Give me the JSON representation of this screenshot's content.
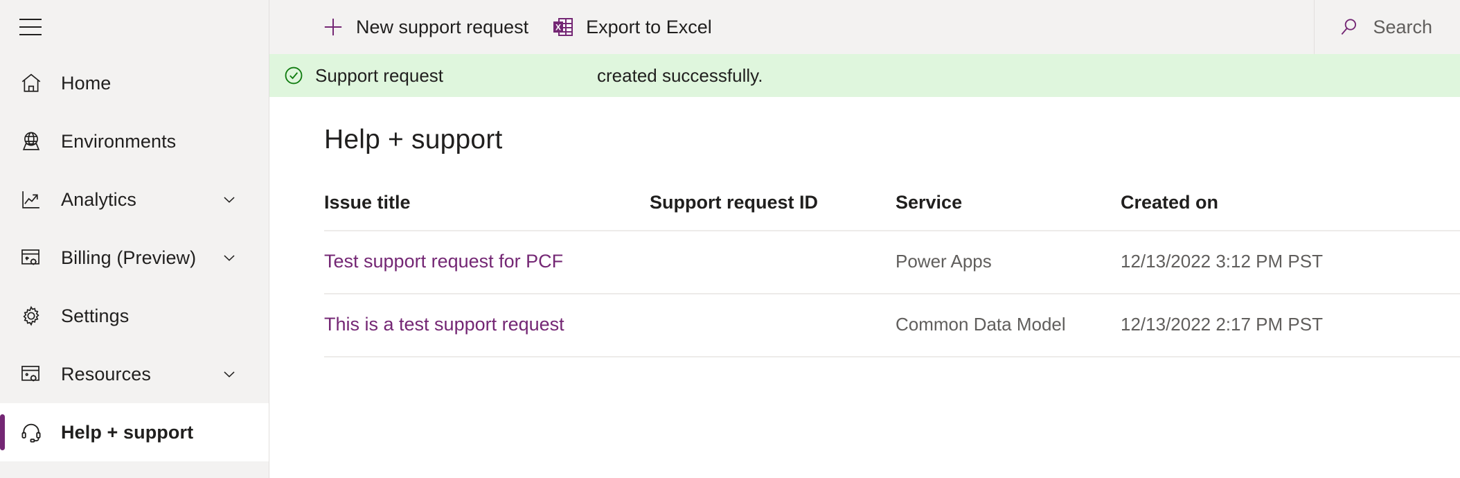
{
  "sidebar": {
    "menu_toggle": "hamburger-menu",
    "items": [
      {
        "label": "Home",
        "icon": "home-icon",
        "chevron": false,
        "active": false
      },
      {
        "label": "Environments",
        "icon": "globe-icon",
        "chevron": false,
        "active": false
      },
      {
        "label": "Analytics",
        "icon": "analytics-icon",
        "chevron": true,
        "active": false
      },
      {
        "label": "Billing (Preview)",
        "icon": "billing-icon",
        "chevron": true,
        "active": false
      },
      {
        "label": "Settings",
        "icon": "gear-icon",
        "chevron": false,
        "active": false
      },
      {
        "label": "Resources",
        "icon": "resources-icon",
        "chevron": true,
        "active": false
      },
      {
        "label": "Help + support",
        "icon": "headset-icon",
        "chevron": false,
        "active": true
      }
    ]
  },
  "commandbar": {
    "new_request_label": "New support request",
    "export_excel_label": "Export to Excel",
    "excel_icon_letter": "X"
  },
  "search": {
    "placeholder": "Search"
  },
  "banner": {
    "icon": "checkmark-circle-icon",
    "prefix": "Support request",
    "request_id": "",
    "suffix": "created successfully."
  },
  "page": {
    "title": "Help + support"
  },
  "table": {
    "columns": [
      "Issue title",
      "Support request ID",
      "Service",
      "Created on"
    ],
    "rows": [
      {
        "issue_title": "Test support request for PCF",
        "support_request_id": "",
        "service": "Power Apps",
        "created_on": "12/13/2022 3:12 PM PST"
      },
      {
        "issue_title": "This is a test support request",
        "support_request_id": "",
        "service": "Common Data Model",
        "created_on": "12/13/2022 2:17 PM PST"
      }
    ]
  },
  "colors": {
    "accent_purple": "#742774",
    "banner_green_bg": "#dff6dd",
    "banner_green_icon": "#107c10",
    "sidebar_bg": "#f3f2f1",
    "text_primary": "#201f1e",
    "text_secondary": "#605e5c"
  }
}
